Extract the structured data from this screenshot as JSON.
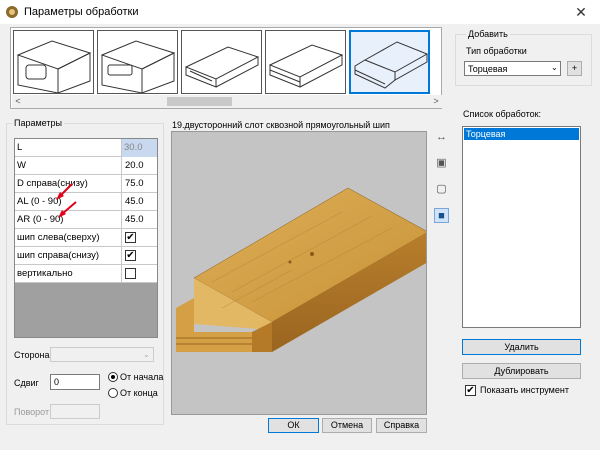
{
  "window": {
    "title": "Параметры обработки",
    "close": "✕"
  },
  "thumbnails": {
    "scroll_left": "<",
    "scroll_right": ">",
    "items": [
      {
        "name": "thumb-1"
      },
      {
        "name": "thumb-2"
      },
      {
        "name": "thumb-3"
      },
      {
        "name": "thumb-4"
      },
      {
        "name": "thumb-5",
        "selected": true
      }
    ]
  },
  "params": {
    "title": "Параметры",
    "rows": [
      {
        "label": "L",
        "value": "30.0",
        "highlight": true
      },
      {
        "label": "W",
        "value": "20.0"
      },
      {
        "label": "D справа(снизу)",
        "value": "75.0"
      },
      {
        "label": "AL (0 - 90)",
        "value": "45.0"
      },
      {
        "label": "AR (0 - 90)",
        "value": "45.0"
      },
      {
        "label": "шип слева(сверху)",
        "checked": true
      },
      {
        "label": "шип справа(снизу)",
        "checked": true
      },
      {
        "label": "вертикально",
        "checked": false
      }
    ],
    "side_label": "Сторона",
    "shift_label": "Сдвиг",
    "shift_value": "0",
    "rotate_label": "Поворот",
    "radio_from_start": "От начала",
    "radio_from_end": "От конца"
  },
  "preview": {
    "title": "19.двусторонний слот сквозной прямоугольный шип"
  },
  "add_panel": {
    "title": "Добавить",
    "type_label": "Тип обработки",
    "type_value": "Торцевая",
    "plus": "+"
  },
  "ops": {
    "title": "Список обработок:",
    "items": [
      "Торцевая"
    ]
  },
  "buttons": {
    "delete": "Удалить",
    "duplicate": "Дублировать",
    "ok": "ОК",
    "cancel": "Отмена",
    "help": "Справка",
    "show_tool": "Показать инструмент"
  },
  "colors": {
    "accent": "#0078d7",
    "arrow_red": "#e0001a",
    "wood_light": "#d9a84e",
    "wood_dark": "#b0782a"
  }
}
